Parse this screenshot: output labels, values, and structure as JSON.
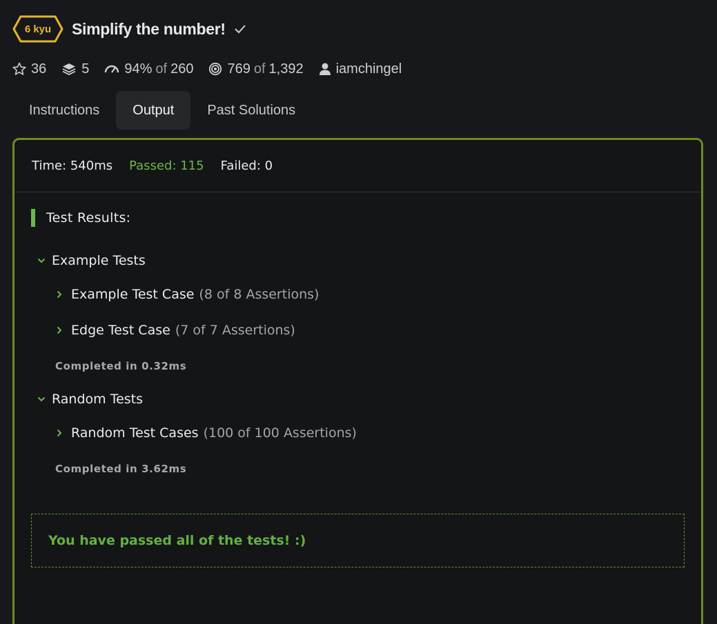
{
  "header": {
    "kyu": "6 kyu",
    "title": "Simplify the number!",
    "rank_color": "#e7b52b"
  },
  "stats": {
    "stars": "36",
    "collections": "5",
    "satisfaction": "94%",
    "satisfaction_of": "of",
    "satisfaction_total": "260",
    "completions": "769",
    "completions_of": "of",
    "completions_total": "1,392",
    "author": "iamchingel"
  },
  "tabs": [
    {
      "label": "Instructions",
      "active": false
    },
    {
      "label": "Output",
      "active": true
    },
    {
      "label": "Past Solutions",
      "active": false
    }
  ],
  "summary": {
    "time": "Time: 540ms",
    "passed": "Passed: 115",
    "failed": "Failed: 0"
  },
  "results": {
    "heading": "Test Results:",
    "groups": [
      {
        "label": "Example Tests",
        "cases": [
          {
            "label": "Example Test Case",
            "count": "(8 of 8 Assertions)"
          },
          {
            "label": "Edge Test Case",
            "count": "(7 of 7 Assertions)"
          }
        ],
        "completed": "Completed in 0.32ms"
      },
      {
        "label": "Random Tests",
        "cases": [
          {
            "label": "Random Test Cases",
            "count": "(100 of 100 Assertions)"
          }
        ],
        "completed": "Completed in 3.62ms"
      }
    ],
    "final_message": "You have passed all of the tests! :)"
  },
  "colors": {
    "panel_border": "#6a8d23",
    "pass_green": "#6bb84a",
    "background": "#17181b"
  }
}
